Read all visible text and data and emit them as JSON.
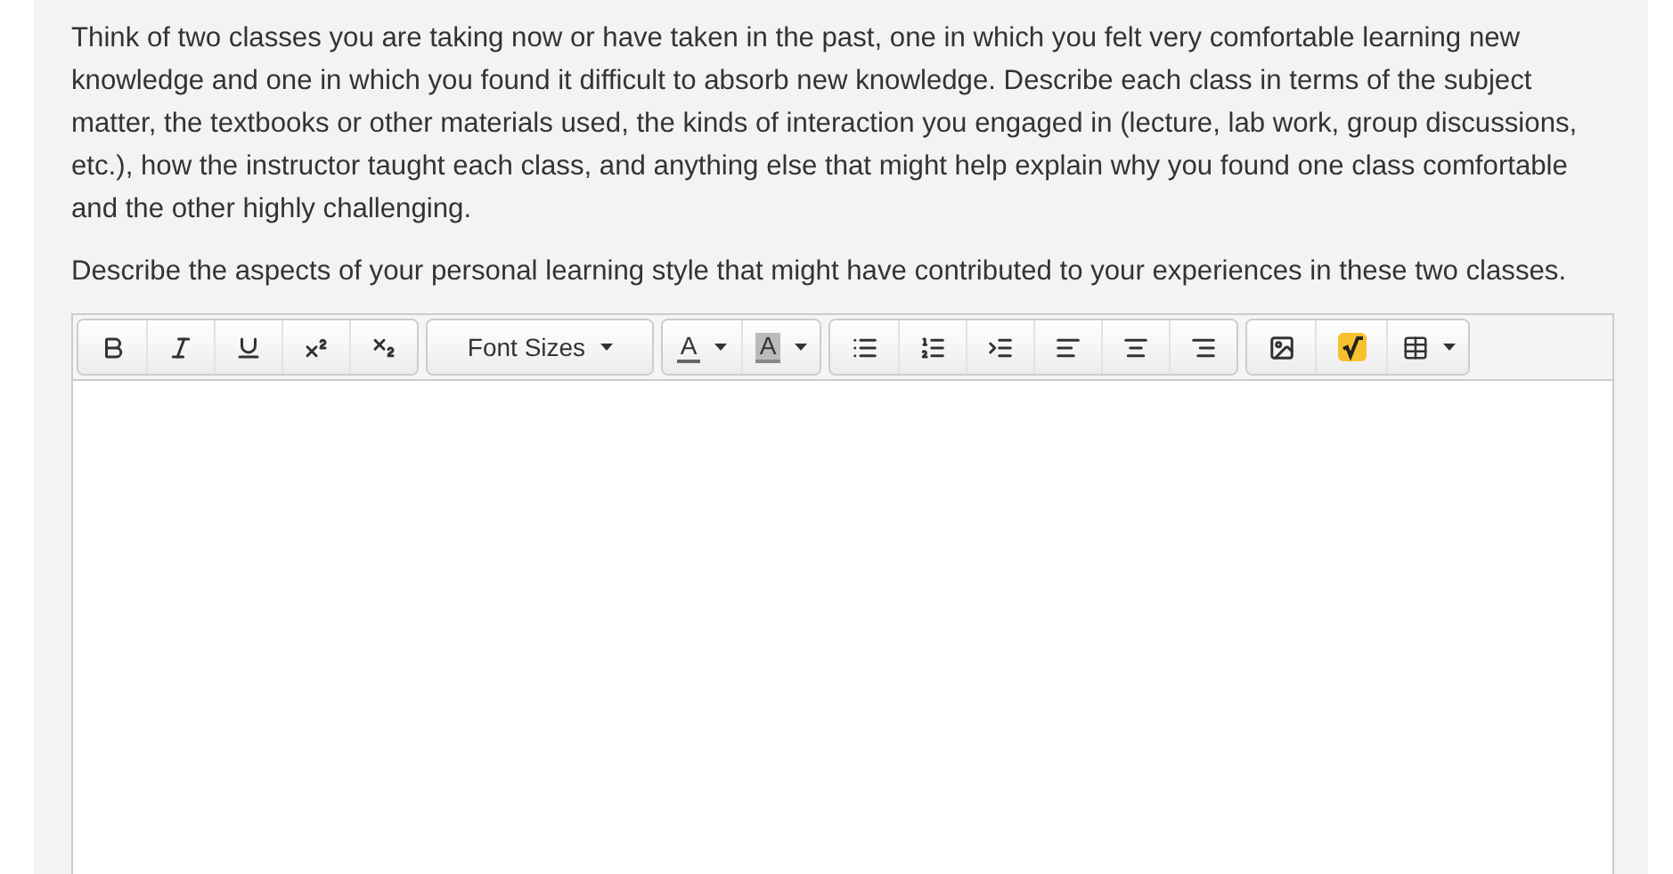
{
  "prompt_paragraphs": [
    "Think of two classes you are taking now or have taken in the past, one in which you felt very comfortable learning new knowledge and one in which you found it difficult to absorb new knowledge. Describe each class in terms of the subject matter, the textbooks or other materials used, the kinds of interaction you engaged in (lecture, lab work, group discussions, etc.), how the instructor taught each class, and anything else that might help explain why you found one class comfortable and the other highly challenging.",
    "Describe the aspects of your personal learning style that might have contributed to your experiences in these two classes."
  ],
  "toolbar": {
    "groups": [
      {
        "buttons": [
          {
            "kind": "bold"
          },
          {
            "kind": "italic"
          },
          {
            "kind": "underline"
          },
          {
            "kind": "superscript"
          },
          {
            "kind": "subscript"
          }
        ]
      },
      {
        "buttons": [
          {
            "kind": "dropdown",
            "label": "Font Sizes"
          }
        ]
      },
      {
        "buttons": [
          {
            "kind": "text-color",
            "label": "A"
          },
          {
            "kind": "highlight-color",
            "label": "A"
          }
        ]
      },
      {
        "buttons": [
          {
            "kind": "bullet-list"
          },
          {
            "kind": "numbered-list"
          },
          {
            "kind": "indent"
          },
          {
            "kind": "align-left"
          },
          {
            "kind": "align-center"
          },
          {
            "kind": "align-right"
          }
        ]
      },
      {
        "buttons": [
          {
            "kind": "image"
          },
          {
            "kind": "math"
          },
          {
            "kind": "table"
          }
        ]
      }
    ]
  }
}
